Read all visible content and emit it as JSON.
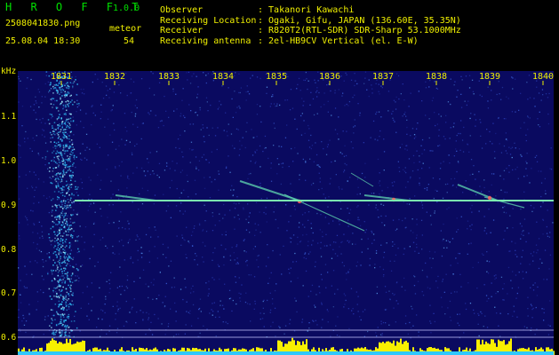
{
  "app": {
    "name": "H R O F F T",
    "version": "1.0.0"
  },
  "file": {
    "name": "2508041830.png",
    "datetime": "25.08.04 18:30"
  },
  "detector": {
    "label": "meteor",
    "count": "54"
  },
  "station": {
    "rows": [
      {
        "key": "Observer",
        "value": ": Takanori Kawachi"
      },
      {
        "key": "Receiving Location",
        "value": ": Ogaki, Gifu, JAPAN (136.60E, 35.35N)"
      },
      {
        "key": "Receiver",
        "value": ": R820T2(RTL-SDR) SDR-Sharp 53.1000MHz"
      },
      {
        "key": "Receiving antenna",
        "value": ": 2el-HB9CV Vertical (el. E-W)"
      }
    ]
  },
  "spectrogram": {
    "y_unit": "kHz",
    "y_ticks": [
      "1.1",
      "1.0",
      "0.9",
      "0.8",
      "0.7",
      "0.6"
    ],
    "x_ticks": [
      "1831",
      "1832",
      "1833",
      "1834",
      "1835",
      "1836",
      "1837",
      "1838",
      "1839",
      "1840"
    ],
    "colors": {
      "background": "#0a0a60",
      "carrier": "#7cf0b0",
      "text": "#f0f000",
      "level": "#f8f000",
      "band": "#30c8ff"
    }
  }
}
